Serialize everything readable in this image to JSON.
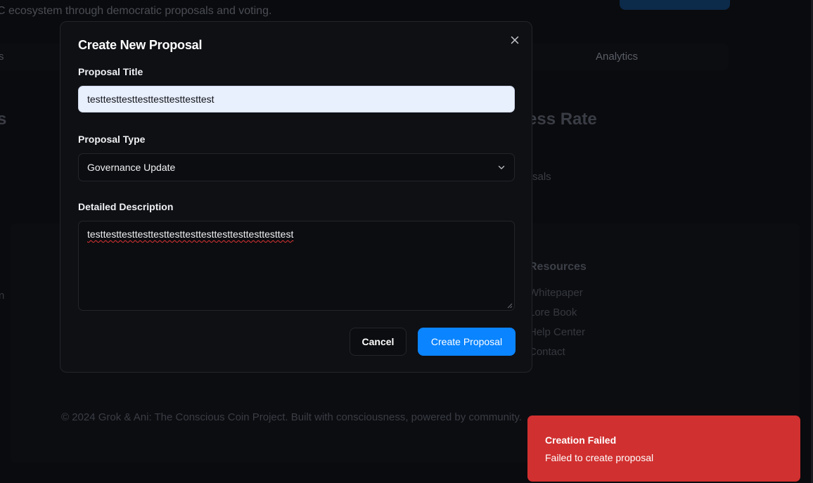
{
  "background": {
    "subtitle": "C ecosystem through democratic proposals and voting.",
    "tab_left": "s",
    "tab_analytics": "Analytics",
    "heading_left": "s",
    "heading_right": "ess Rate",
    "proposals_text": "sals",
    "footer": {
      "resources_title": "Resources",
      "links": [
        "Whitepaper",
        "Lore Book",
        "Help Center",
        "Contact"
      ],
      "left_letter": "n",
      "copyright": "© 2024 Grok & Ani: The Conscious Coin Project. Built with consciousness, powered by community."
    }
  },
  "modal": {
    "title": "Create New Proposal",
    "close_icon": "close-icon",
    "fields": {
      "title_label": "Proposal Title",
      "title_value": "testtesttesttesttesttesttesttest",
      "type_label": "Proposal Type",
      "type_value": "Governance Update",
      "description_label": "Detailed Description",
      "description_value": "testtesttesttesttesttesttesttesttesttesttesttesttest"
    },
    "buttons": {
      "cancel": "Cancel",
      "create": "Create Proposal"
    }
  },
  "toast": {
    "title": "Creation Failed",
    "message": "Failed to create proposal",
    "color": "#d13030"
  },
  "colors": {
    "accent": "#0a84ff",
    "modal_bg": "#0f1014",
    "input_bg": "#e8effd"
  }
}
